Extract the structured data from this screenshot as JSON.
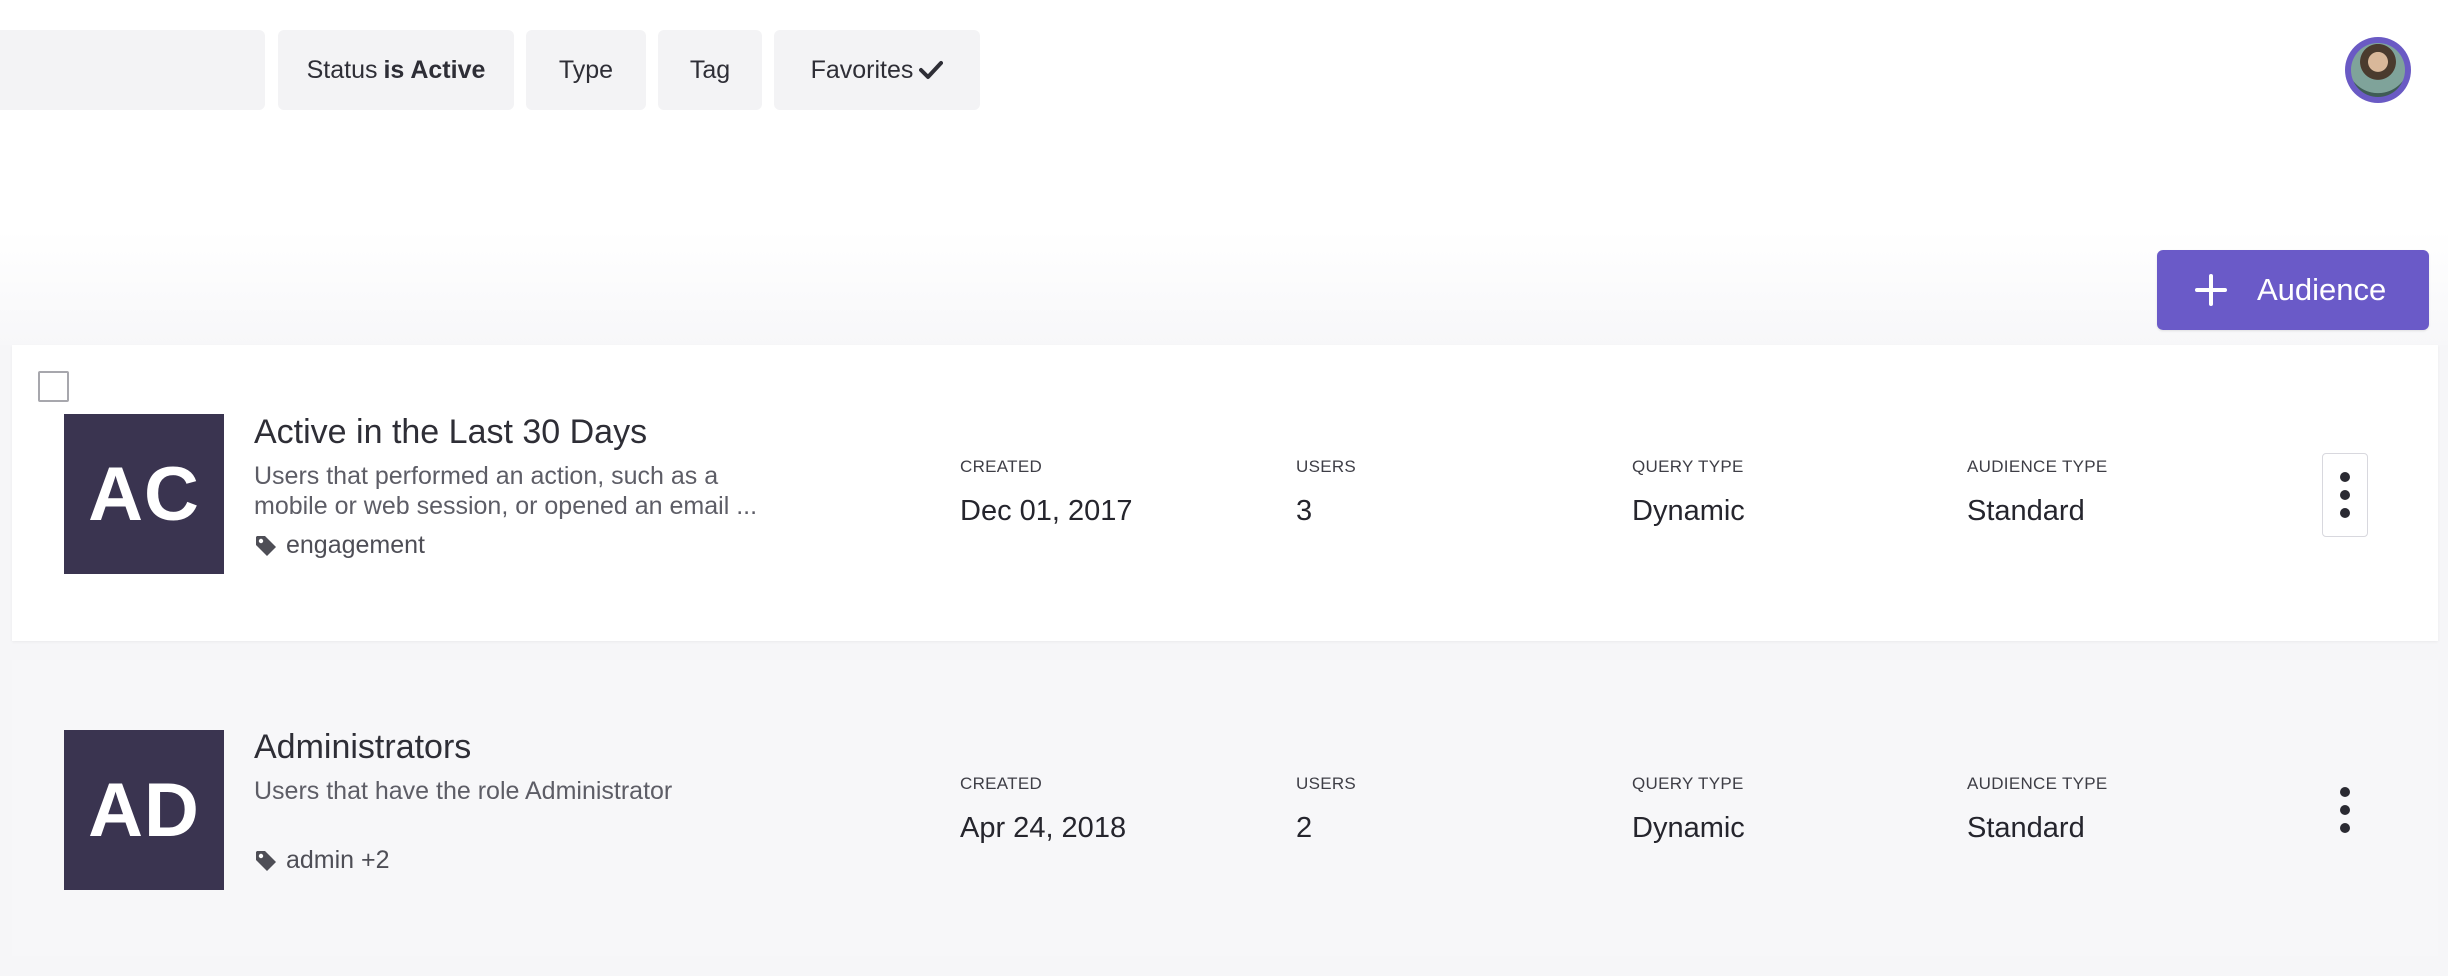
{
  "filters": {
    "search_placeholder": "",
    "status_label": "Status",
    "status_value": "is Active",
    "type_label": "Type",
    "tag_label": "Tag",
    "favorites_label": "Favorites"
  },
  "actions": {
    "add_audience_label": "Audience"
  },
  "columns": {
    "created": "CREATED",
    "users": "USERS",
    "query_type": "QUERY TYPE",
    "audience_type": "AUDIENCE TYPE"
  },
  "audiences": [
    {
      "initials": "AC",
      "title": "Active in the Last 30 Days",
      "description": "Users that performed an action, such as a mobile or web session, or opened an email ...",
      "tags": "engagement",
      "created": "Dec 01, 2017",
      "users": "3",
      "query_type": "Dynamic",
      "audience_type": "Standard"
    },
    {
      "initials": "AD",
      "title": "Administrators",
      "description": "Users that have the role Administrator",
      "tags": "admin +2",
      "created": "Apr 24, 2018",
      "users": "2",
      "query_type": "Dynamic",
      "audience_type": "Standard"
    }
  ],
  "colors": {
    "accent": "#6a5ac8",
    "initials_bg": "#3a3450",
    "chip_bg": "#f3f3f5"
  }
}
